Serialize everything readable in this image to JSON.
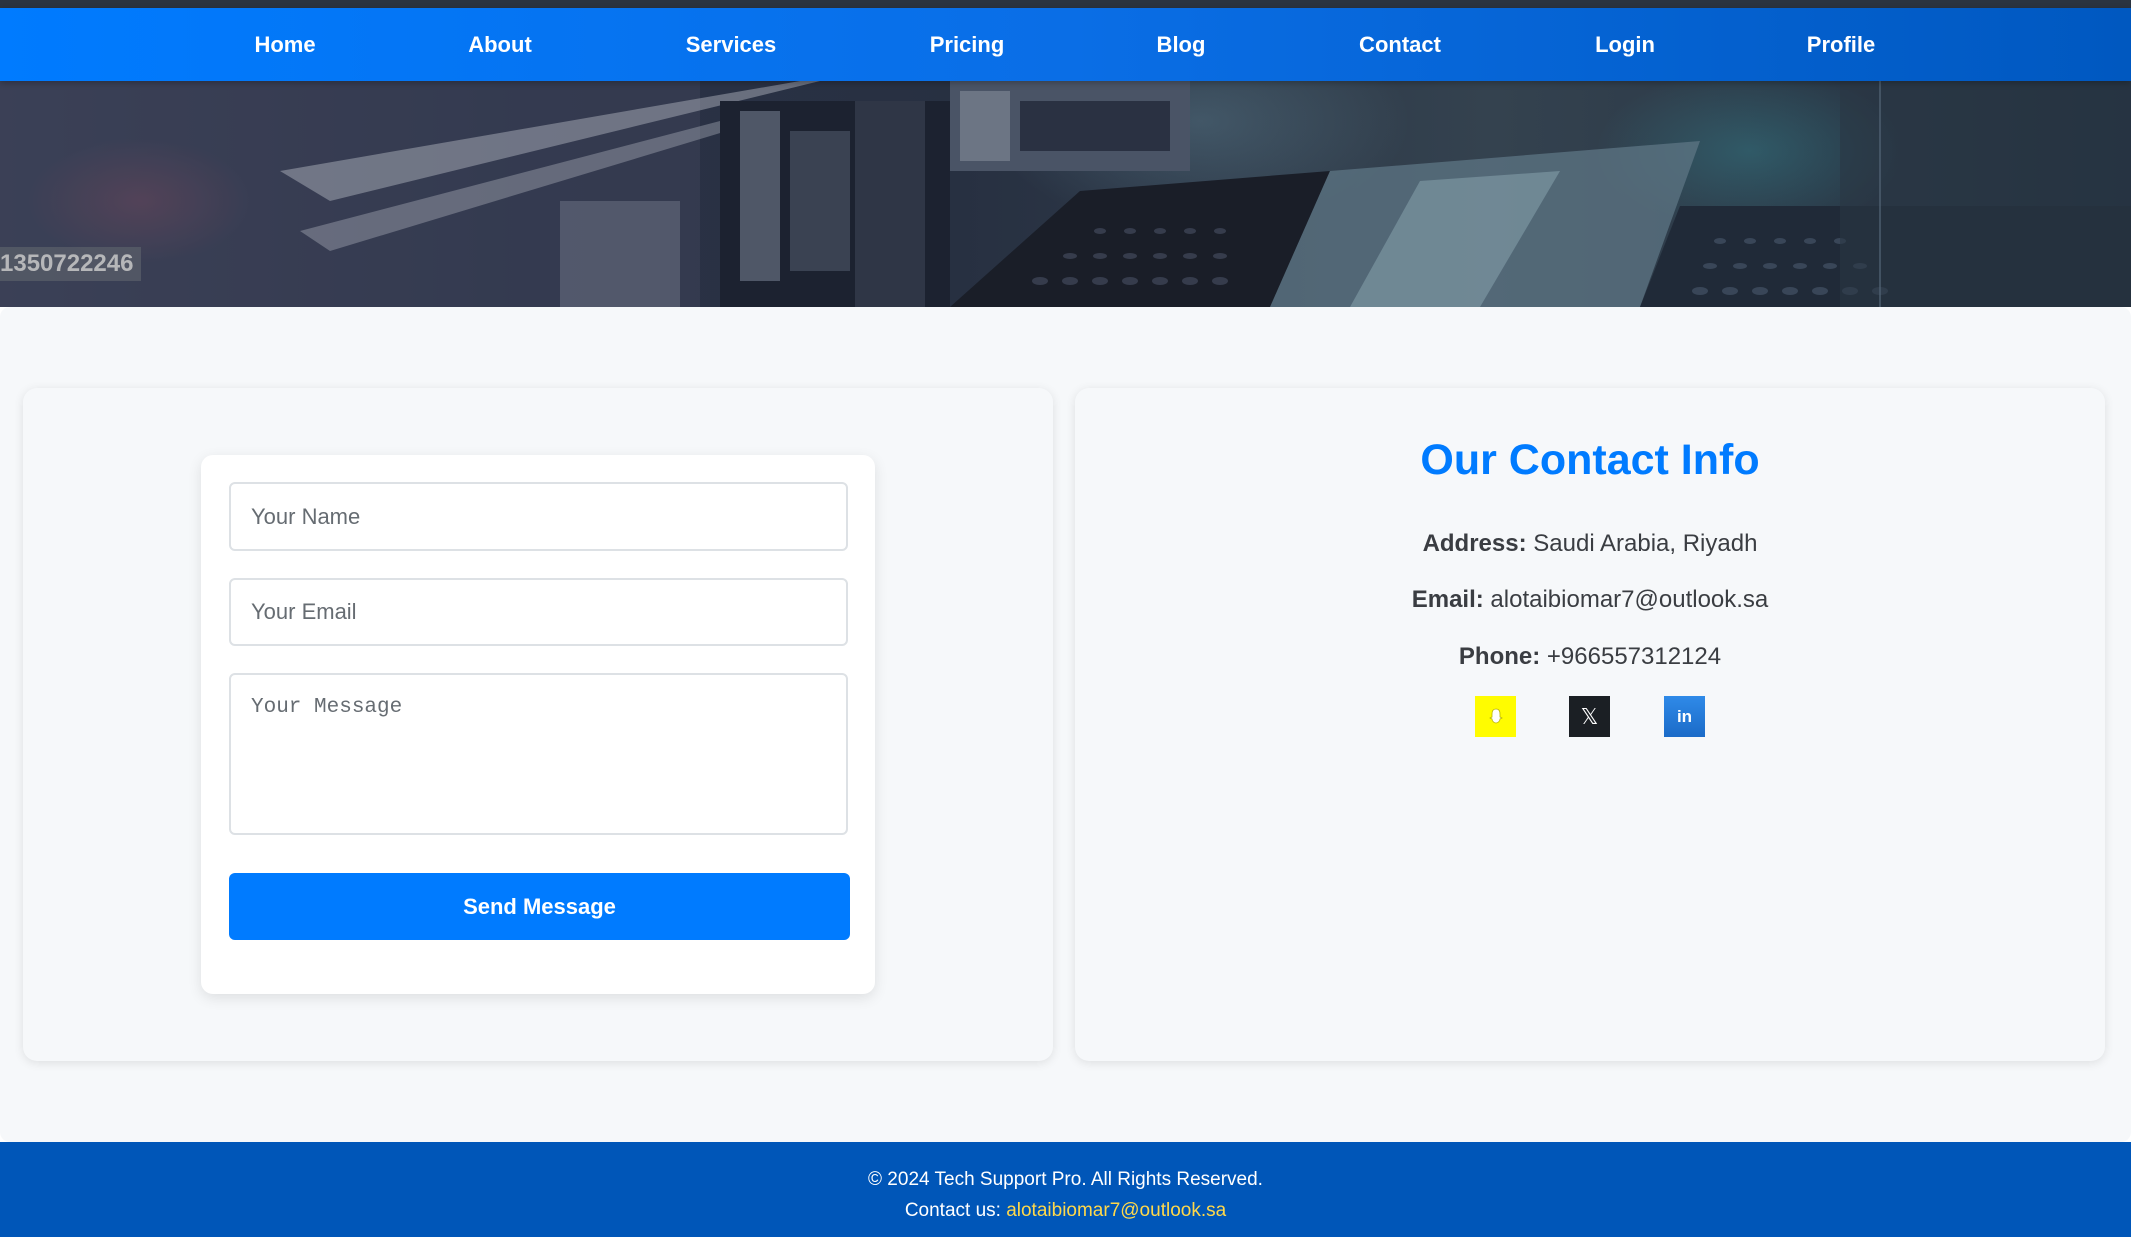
{
  "nav": {
    "items": [
      {
        "label": "Home"
      },
      {
        "label": "About"
      },
      {
        "label": "Services"
      },
      {
        "label": "Pricing"
      },
      {
        "label": "Blog"
      },
      {
        "label": "Contact"
      },
      {
        "label": "Login"
      },
      {
        "label": "Profile"
      }
    ]
  },
  "hero": {
    "image_id_text": "1350722246"
  },
  "form": {
    "name_placeholder": "Your Name",
    "email_placeholder": "Your Email",
    "message_placeholder": "Your Message",
    "submit_label": "Send Message"
  },
  "contact_info": {
    "title": "Our Contact Info",
    "address_label": "Address:",
    "address_value": "Saudi Arabia, Riyadh",
    "email_label": "Email:",
    "email_value": "alotaibiomar7@outlook.sa",
    "phone_label": "Phone:",
    "phone_value": "+966557312124",
    "social": [
      {
        "name": "snapchat-icon",
        "color": "#fffc00"
      },
      {
        "name": "x-icon",
        "glyph": "𝕏",
        "color": "#1b1f24"
      },
      {
        "name": "linkedin-icon",
        "glyph": "in",
        "color": "#1b6bc8"
      }
    ]
  },
  "footer": {
    "copyright": "© 2024 Tech Support Pro. All Rights Reserved.",
    "contact_prefix": "Contact us:",
    "contact_email": "alotaibiomar7@outlook.sa"
  },
  "colors": {
    "primary": "#007bff",
    "footer_bg": "#0056b8",
    "footer_link": "#ffd84a"
  }
}
